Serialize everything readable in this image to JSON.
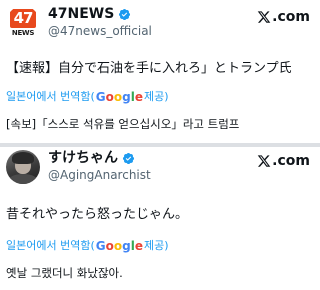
{
  "posts": [
    {
      "display_name": "47NEWS",
      "handle": "@47news_official",
      "avatar_text_top": "47",
      "avatar_text_bottom": "NEWS",
      "site_label": ".com",
      "text": "【速報】自分で石油を手に入れろ」とトランプ氏",
      "translate_prefix": "일본어에서 번역함(",
      "translate_suffix": " 제공)",
      "google_letters": [
        "G",
        "o",
        "o",
        "g",
        "l",
        "e"
      ],
      "translated_text": "[속보]「스스로 석유를 얻으십시오」라고 트럼프"
    },
    {
      "display_name": "すけちゃん",
      "handle": "@AgingAnarchist",
      "site_label": ".com",
      "text": "昔それやったら怒ったじゃん。",
      "translate_prefix": "일본어에서 번역함(",
      "translate_suffix": " 제공)",
      "google_letters": [
        "G",
        "o",
        "o",
        "g",
        "l",
        "e"
      ],
      "translated_text": "옛날 그랬더니 화났잖아."
    }
  ],
  "colors": {
    "verified": "#1d9bf0",
    "translate_link": "#1d9bf0",
    "handle": "#536471",
    "avatar_brand": "#e8491d",
    "google_blue": "#4285f4",
    "google_red": "#ea4335",
    "google_yellow": "#fbbc05",
    "google_green": "#34a853"
  },
  "icons": {
    "verified": "verified-badge-icon",
    "site": "x-logo-icon"
  }
}
